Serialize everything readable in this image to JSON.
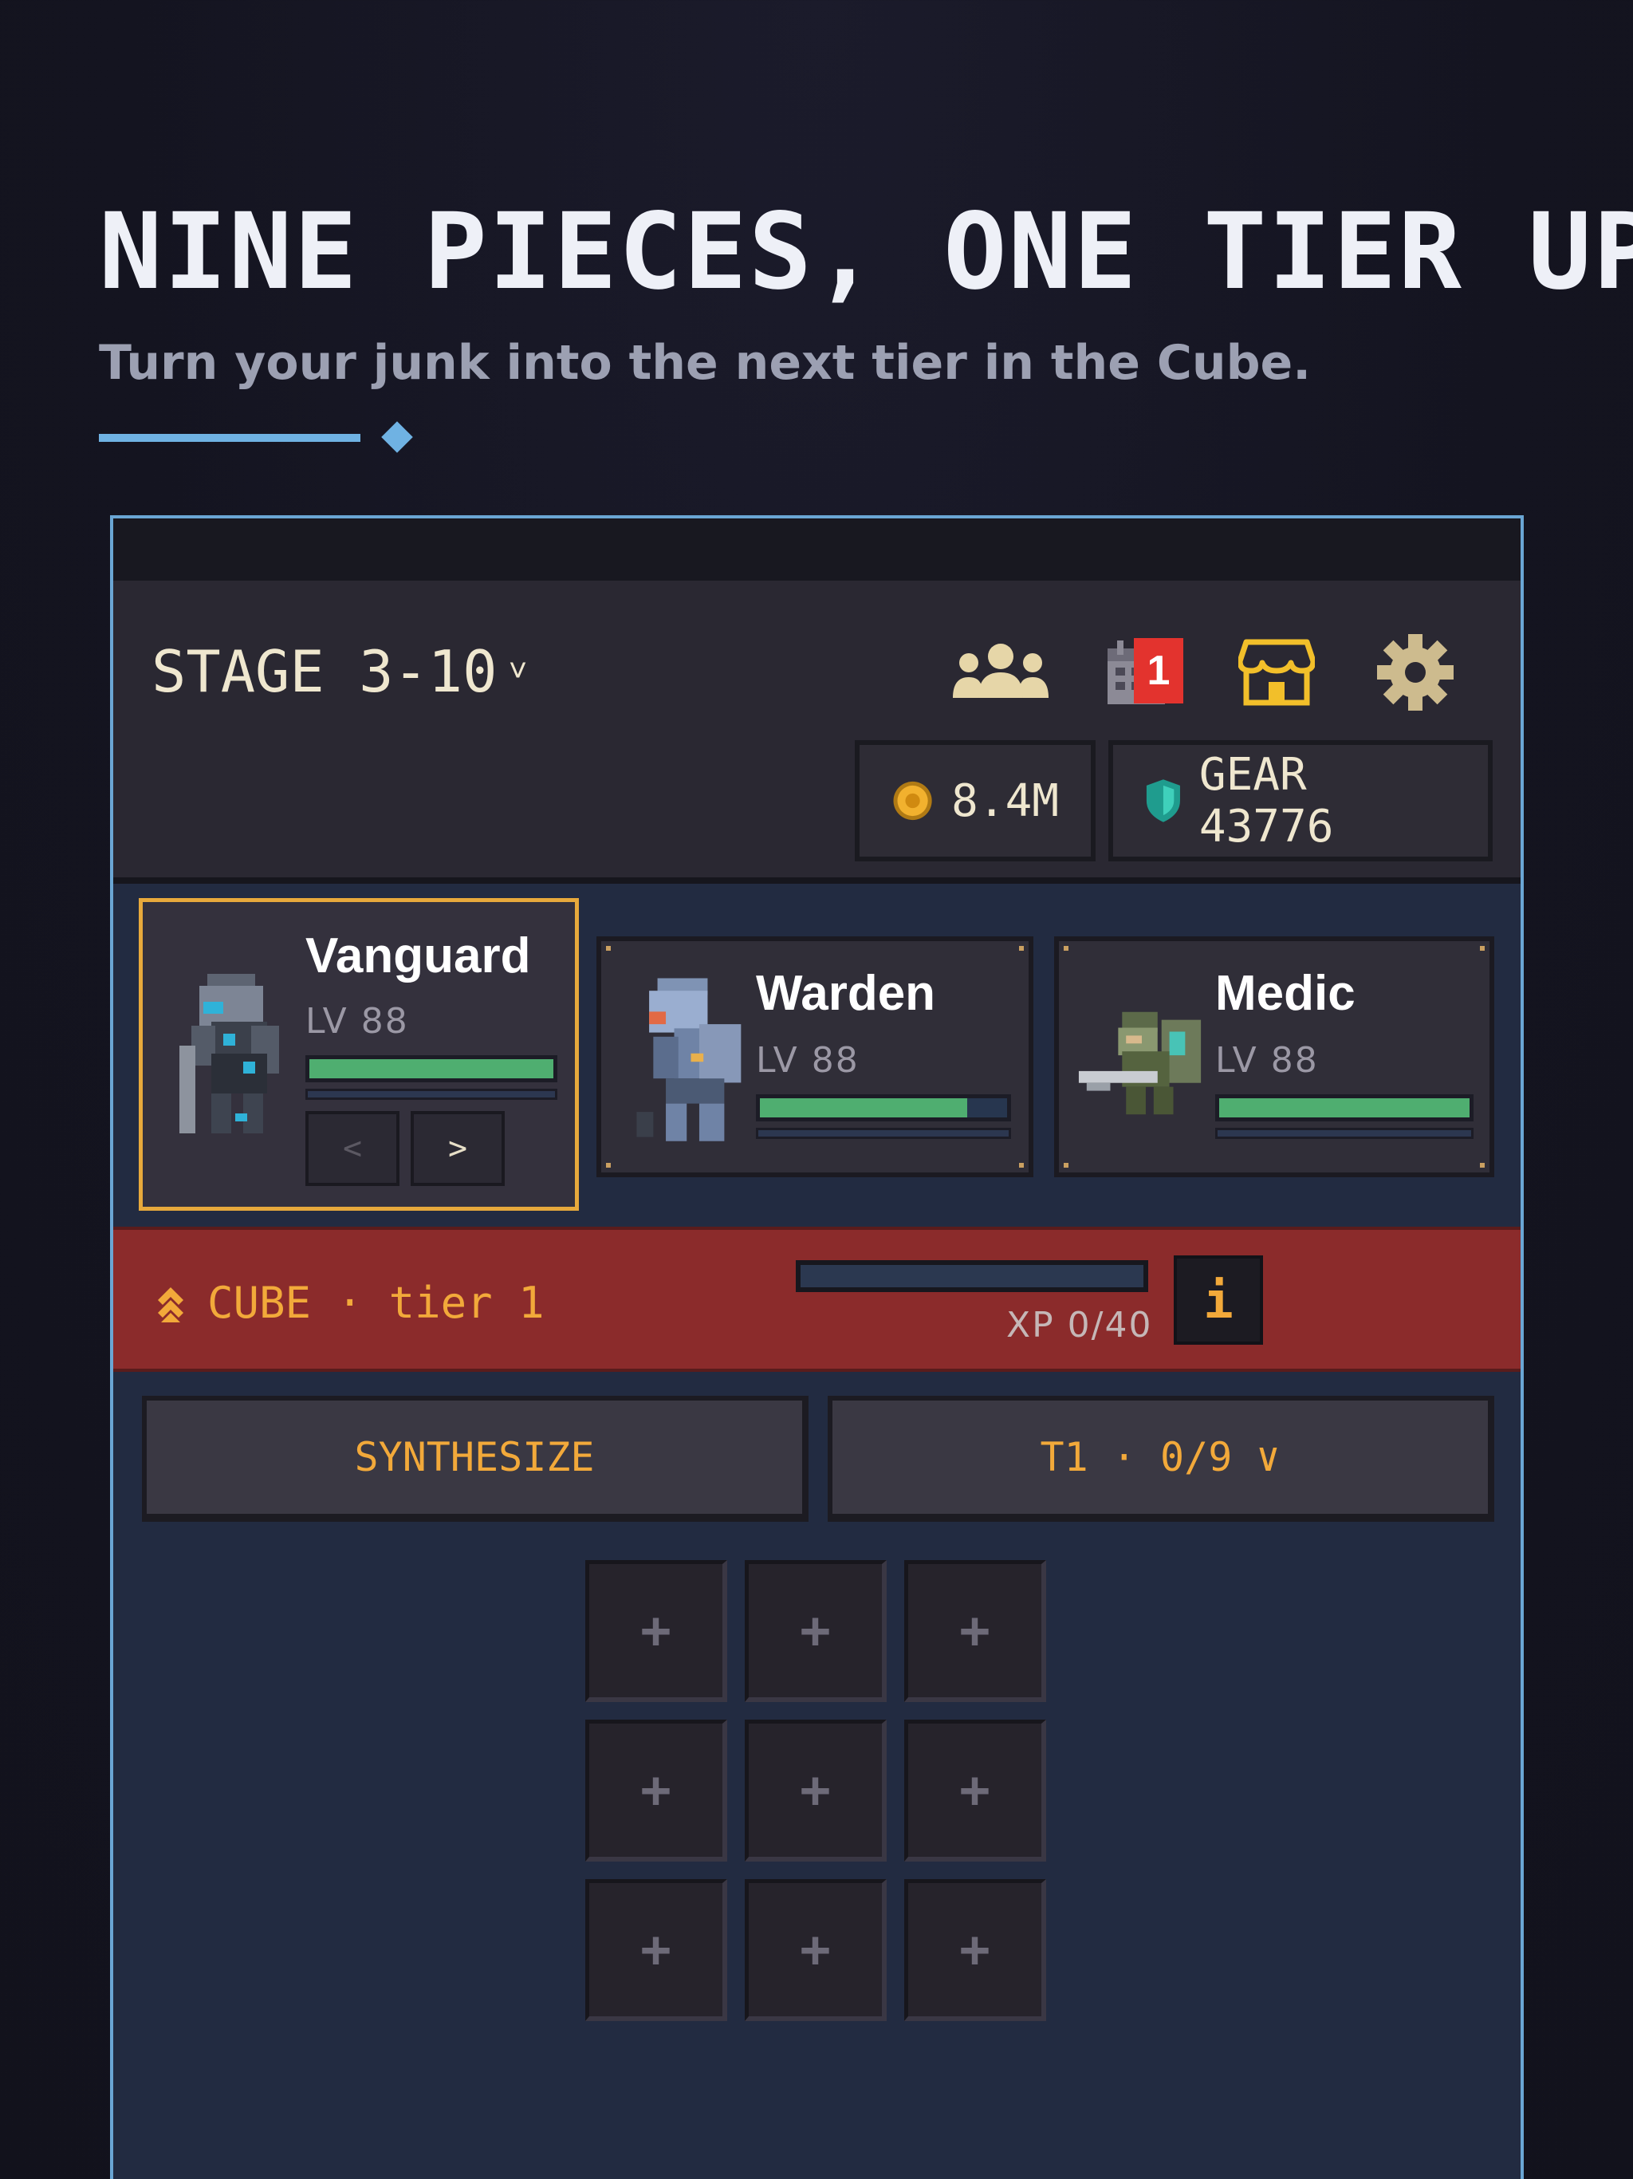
{
  "promo": {
    "headline": "NINE PIECES, ONE TIER UP",
    "subline": "Turn your junk into the next tier in the Cube."
  },
  "topbar": {
    "stage": "STAGE 3-10",
    "stage_chevron": "˅",
    "icons": [
      "group-icon",
      "calendar-icon",
      "shop-icon",
      "gear-icon"
    ],
    "calendar_badge": "1",
    "coins": "8.4M",
    "gear_label": "GEAR 43776"
  },
  "heroes": [
    {
      "name": "Vanguard",
      "level": "LV 88",
      "hp": 1.0,
      "xp": 0.0
    },
    {
      "name": "Warden",
      "level": "LV 88",
      "hp": 0.84,
      "xp": 0.0
    },
    {
      "name": "Medic",
      "level": "LV 88",
      "hp": 1.0,
      "xp": 0.0
    }
  ],
  "hero_nav": {
    "prev": "<",
    "next": ">"
  },
  "cube": {
    "title": "CUBE · tier 1",
    "xp_text": "XP 0/40",
    "xp_fraction": 0,
    "info_label": "i"
  },
  "actions": {
    "synthesize": "SYNTHESIZE",
    "filter": "T1 · 0/9 ∨"
  },
  "slots": [
    "+",
    "+",
    "+",
    "+",
    "+",
    "+",
    "+",
    "+",
    "+"
  ],
  "colors": {
    "accent": "#f2a93a",
    "selected_border": "#e7a93c",
    "hp": "#4fae70",
    "cube_bar": "#8b2b2b",
    "frame": "#6aa6d4"
  }
}
